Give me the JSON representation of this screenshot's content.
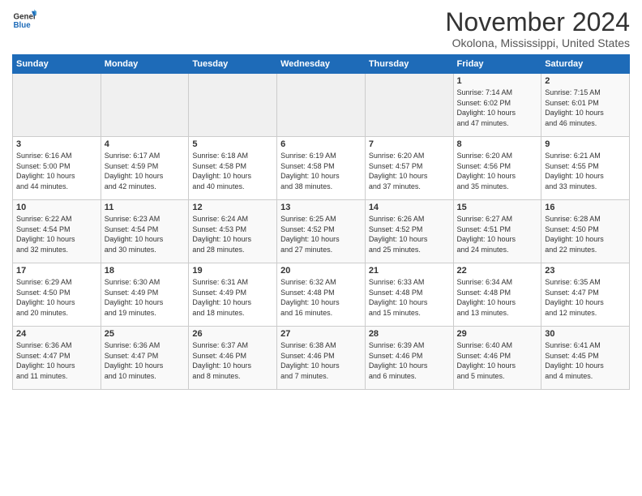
{
  "logo": {
    "general": "General",
    "blue": "Blue"
  },
  "title": "November 2024",
  "location": "Okolona, Mississippi, United States",
  "weekdays": [
    "Sunday",
    "Monday",
    "Tuesday",
    "Wednesday",
    "Thursday",
    "Friday",
    "Saturday"
  ],
  "weeks": [
    [
      {
        "day": "",
        "info": ""
      },
      {
        "day": "",
        "info": ""
      },
      {
        "day": "",
        "info": ""
      },
      {
        "day": "",
        "info": ""
      },
      {
        "day": "",
        "info": ""
      },
      {
        "day": "1",
        "info": "Sunrise: 7:14 AM\nSunset: 6:02 PM\nDaylight: 10 hours\nand 47 minutes."
      },
      {
        "day": "2",
        "info": "Sunrise: 7:15 AM\nSunset: 6:01 PM\nDaylight: 10 hours\nand 46 minutes."
      }
    ],
    [
      {
        "day": "3",
        "info": "Sunrise: 6:16 AM\nSunset: 5:00 PM\nDaylight: 10 hours\nand 44 minutes."
      },
      {
        "day": "4",
        "info": "Sunrise: 6:17 AM\nSunset: 4:59 PM\nDaylight: 10 hours\nand 42 minutes."
      },
      {
        "day": "5",
        "info": "Sunrise: 6:18 AM\nSunset: 4:58 PM\nDaylight: 10 hours\nand 40 minutes."
      },
      {
        "day": "6",
        "info": "Sunrise: 6:19 AM\nSunset: 4:58 PM\nDaylight: 10 hours\nand 38 minutes."
      },
      {
        "day": "7",
        "info": "Sunrise: 6:20 AM\nSunset: 4:57 PM\nDaylight: 10 hours\nand 37 minutes."
      },
      {
        "day": "8",
        "info": "Sunrise: 6:20 AM\nSunset: 4:56 PM\nDaylight: 10 hours\nand 35 minutes."
      },
      {
        "day": "9",
        "info": "Sunrise: 6:21 AM\nSunset: 4:55 PM\nDaylight: 10 hours\nand 33 minutes."
      }
    ],
    [
      {
        "day": "10",
        "info": "Sunrise: 6:22 AM\nSunset: 4:54 PM\nDaylight: 10 hours\nand 32 minutes."
      },
      {
        "day": "11",
        "info": "Sunrise: 6:23 AM\nSunset: 4:54 PM\nDaylight: 10 hours\nand 30 minutes."
      },
      {
        "day": "12",
        "info": "Sunrise: 6:24 AM\nSunset: 4:53 PM\nDaylight: 10 hours\nand 28 minutes."
      },
      {
        "day": "13",
        "info": "Sunrise: 6:25 AM\nSunset: 4:52 PM\nDaylight: 10 hours\nand 27 minutes."
      },
      {
        "day": "14",
        "info": "Sunrise: 6:26 AM\nSunset: 4:52 PM\nDaylight: 10 hours\nand 25 minutes."
      },
      {
        "day": "15",
        "info": "Sunrise: 6:27 AM\nSunset: 4:51 PM\nDaylight: 10 hours\nand 24 minutes."
      },
      {
        "day": "16",
        "info": "Sunrise: 6:28 AM\nSunset: 4:50 PM\nDaylight: 10 hours\nand 22 minutes."
      }
    ],
    [
      {
        "day": "17",
        "info": "Sunrise: 6:29 AM\nSunset: 4:50 PM\nDaylight: 10 hours\nand 20 minutes."
      },
      {
        "day": "18",
        "info": "Sunrise: 6:30 AM\nSunset: 4:49 PM\nDaylight: 10 hours\nand 19 minutes."
      },
      {
        "day": "19",
        "info": "Sunrise: 6:31 AM\nSunset: 4:49 PM\nDaylight: 10 hours\nand 18 minutes."
      },
      {
        "day": "20",
        "info": "Sunrise: 6:32 AM\nSunset: 4:48 PM\nDaylight: 10 hours\nand 16 minutes."
      },
      {
        "day": "21",
        "info": "Sunrise: 6:33 AM\nSunset: 4:48 PM\nDaylight: 10 hours\nand 15 minutes."
      },
      {
        "day": "22",
        "info": "Sunrise: 6:34 AM\nSunset: 4:48 PM\nDaylight: 10 hours\nand 13 minutes."
      },
      {
        "day": "23",
        "info": "Sunrise: 6:35 AM\nSunset: 4:47 PM\nDaylight: 10 hours\nand 12 minutes."
      }
    ],
    [
      {
        "day": "24",
        "info": "Sunrise: 6:36 AM\nSunset: 4:47 PM\nDaylight: 10 hours\nand 11 minutes."
      },
      {
        "day": "25",
        "info": "Sunrise: 6:36 AM\nSunset: 4:47 PM\nDaylight: 10 hours\nand 10 minutes."
      },
      {
        "day": "26",
        "info": "Sunrise: 6:37 AM\nSunset: 4:46 PM\nDaylight: 10 hours\nand 8 minutes."
      },
      {
        "day": "27",
        "info": "Sunrise: 6:38 AM\nSunset: 4:46 PM\nDaylight: 10 hours\nand 7 minutes."
      },
      {
        "day": "28",
        "info": "Sunrise: 6:39 AM\nSunset: 4:46 PM\nDaylight: 10 hours\nand 6 minutes."
      },
      {
        "day": "29",
        "info": "Sunrise: 6:40 AM\nSunset: 4:46 PM\nDaylight: 10 hours\nand 5 minutes."
      },
      {
        "day": "30",
        "info": "Sunrise: 6:41 AM\nSunset: 4:45 PM\nDaylight: 10 hours\nand 4 minutes."
      }
    ]
  ]
}
